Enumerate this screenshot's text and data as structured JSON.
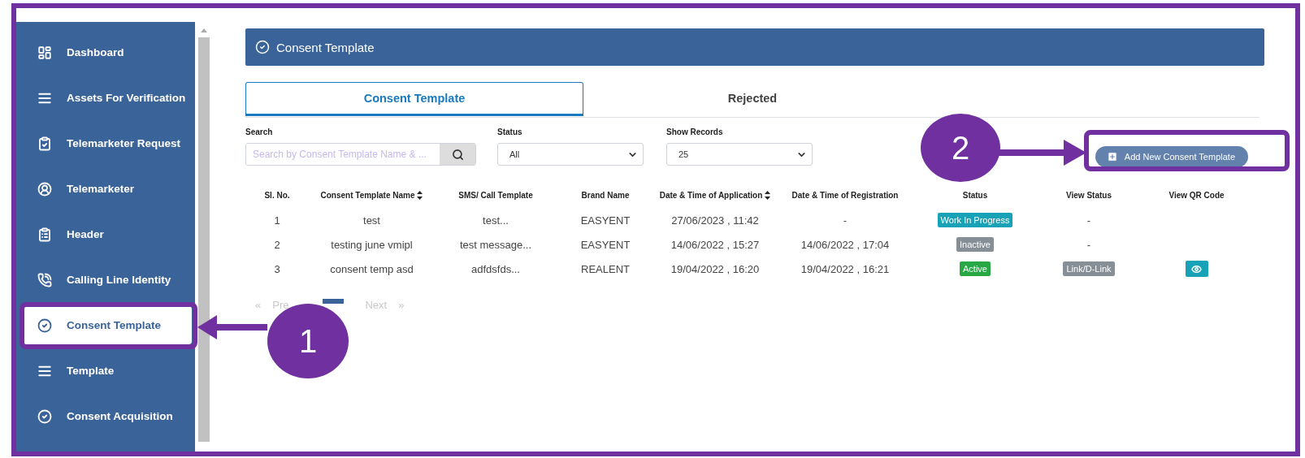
{
  "sidebar": {
    "items": [
      {
        "label": "Dashboard",
        "kind": "dashboard",
        "selected": false
      },
      {
        "label": "Assets For Verification",
        "kind": "list",
        "selected": false
      },
      {
        "label": "Telemarketer Request",
        "kind": "clipboard-check",
        "selected": false
      },
      {
        "label": "Telemarketer",
        "kind": "user",
        "selected": false
      },
      {
        "label": "Header",
        "kind": "clipboard",
        "selected": false
      },
      {
        "label": "Calling Line Identity",
        "kind": "phone",
        "selected": false
      },
      {
        "label": "Consent Template",
        "kind": "check",
        "selected": true
      },
      {
        "label": "Template",
        "kind": "list",
        "selected": false
      },
      {
        "label": "Consent Acquisition",
        "kind": "check",
        "selected": false
      }
    ]
  },
  "header": {
    "title": "Consent Template"
  },
  "tabs": [
    {
      "label": "Consent Template",
      "selected": true
    },
    {
      "label": "Rejected",
      "selected": false
    }
  ],
  "filters": {
    "search": {
      "label": "Search",
      "placeholder": "Search by Consent Template Name & ..."
    },
    "status": {
      "label": "Status",
      "value": "All"
    },
    "records": {
      "label": "Show Records",
      "value": "25"
    }
  },
  "add_button": {
    "label": "Add New Consent Template"
  },
  "table": {
    "columns": [
      {
        "label": "Sl. No.",
        "sortable": false
      },
      {
        "label": "Consent Template Name",
        "sortable": true
      },
      {
        "label": "SMS/ Call Template",
        "sortable": false
      },
      {
        "label": "Brand Name",
        "sortable": false
      },
      {
        "label": "Date & Time of Application",
        "sortable": true
      },
      {
        "label": "Date & Time of Registration",
        "sortable": false
      },
      {
        "label": "Status",
        "sortable": false
      },
      {
        "label": "View Status",
        "sortable": false
      },
      {
        "label": "View QR Code",
        "sortable": false
      }
    ],
    "rows": [
      {
        "cells": [
          "1",
          "test",
          "test...",
          "EASYENT",
          "27/06/2023 , 11:42",
          "-"
        ],
        "status": {
          "label": "Work In Progress",
          "color": "#17a2b8"
        },
        "view_status": {
          "kind": "text",
          "label": "-"
        },
        "qr": {
          "kind": "none"
        }
      },
      {
        "cells": [
          "2",
          "testing june vmipl",
          "test message...",
          "EASYENT",
          "14/06/2022 , 15:27",
          "14/06/2022 , 17:04"
        ],
        "status": {
          "label": "Inactive",
          "color": "#868e96"
        },
        "view_status": {
          "kind": "text",
          "label": "-"
        },
        "qr": {
          "kind": "none"
        }
      },
      {
        "cells": [
          "3",
          "consent temp asd",
          "adfdsfds...",
          "REALENT",
          "19/04/2022 , 16:20",
          "19/04/2022 , 16:21"
        ],
        "status": {
          "label": "Active",
          "color": "#28a745"
        },
        "view_status": {
          "kind": "badge",
          "label": "Link/D-Link"
        },
        "qr": {
          "kind": "button"
        }
      }
    ]
  },
  "pagination": {
    "first": "«",
    "prev": "Pre",
    "next": "Next",
    "last": "»"
  },
  "callouts": [
    {
      "number": "1"
    },
    {
      "number": "2"
    }
  ]
}
